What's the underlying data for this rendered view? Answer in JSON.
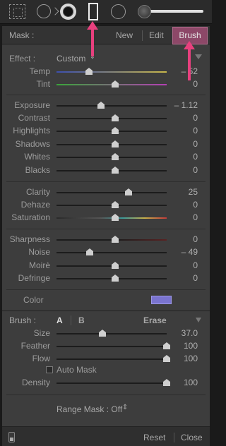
{
  "toolbar": {
    "tools": [
      {
        "icon": "crop-overlay-icon"
      },
      {
        "icon": "spot-removal-icon"
      },
      {
        "icon": "red-eye-icon"
      },
      {
        "icon": "graduated-filter-icon",
        "active": true
      },
      {
        "icon": "radial-filter-icon"
      },
      {
        "icon": "adjustment-brush-icon"
      }
    ]
  },
  "mask": {
    "label": "Mask :",
    "new_label": "New",
    "edit_label": "Edit",
    "brush_label": "Brush"
  },
  "effect": {
    "label": "Effect :",
    "value": "Custom",
    "caret": "⇕"
  },
  "sliders": {
    "temp": {
      "label": "Temp",
      "value": "– 52"
    },
    "tint": {
      "label": "Tint",
      "value": "0"
    },
    "exposure": {
      "label": "Exposure",
      "value": "– 1.12"
    },
    "contrast": {
      "label": "Contrast",
      "value": "0"
    },
    "highlights": {
      "label": "Highlights",
      "value": "0"
    },
    "shadows": {
      "label": "Shadows",
      "value": "0"
    },
    "whites": {
      "label": "Whites",
      "value": "0"
    },
    "blacks": {
      "label": "Blacks",
      "value": "0"
    },
    "clarity": {
      "label": "Clarity",
      "value": "25"
    },
    "dehaze": {
      "label": "Dehaze",
      "value": "0"
    },
    "saturation": {
      "label": "Saturation",
      "value": "0"
    },
    "sharpness": {
      "label": "Sharpness",
      "value": "0"
    },
    "noise": {
      "label": "Noise",
      "value": "– 49"
    },
    "moire": {
      "label": "Moirè",
      "value": "0"
    },
    "defringe": {
      "label": "Defringe",
      "value": "0"
    }
  },
  "color": {
    "label": "Color",
    "swatch": "#7a74cf"
  },
  "brush": {
    "label": "Brush :",
    "a_label": "A",
    "b_label": "B",
    "erase_label": "Erase",
    "size": {
      "label": "Size",
      "value": "37.0"
    },
    "feather": {
      "label": "Feather",
      "value": "100"
    },
    "flow": {
      "label": "Flow",
      "value": "100"
    },
    "automask_label": "Auto Mask",
    "density": {
      "label": "Density",
      "value": "100"
    }
  },
  "range_mask": {
    "label": "Range Mask : Off",
    "caret": "⇕"
  },
  "footer": {
    "reset_label": "Reset",
    "close_label": "Close"
  },
  "colors": {
    "accent": "#8d4868",
    "annotation_arrow": "#e8407e"
  }
}
